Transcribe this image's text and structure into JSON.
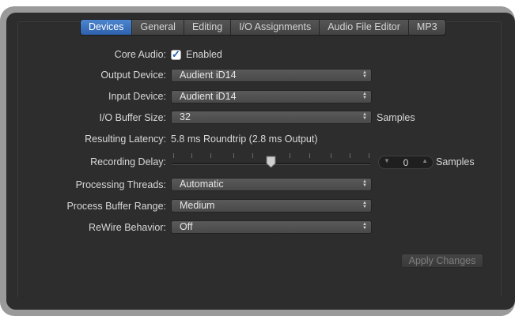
{
  "tabs": [
    "Devices",
    "General",
    "Editing",
    "I/O Assignments",
    "Audio File Editor",
    "MP3"
  ],
  "core_audio": {
    "label": "Core Audio:",
    "checkbox_label": "Enabled",
    "checked": true
  },
  "output_device": {
    "label": "Output Device:",
    "value": "Audient iD14"
  },
  "input_device": {
    "label": "Input Device:",
    "value": "Audient iD14"
  },
  "io_buffer": {
    "label": "I/O Buffer Size:",
    "value": "32",
    "unit": "Samples"
  },
  "latency": {
    "label": "Resulting Latency:",
    "value": "5.8 ms Roundtrip (2.8 ms Output)"
  },
  "recording_delay": {
    "label": "Recording Delay:",
    "value": "0",
    "unit": "Samples"
  },
  "processing_threads": {
    "label": "Processing Threads:",
    "value": "Automatic"
  },
  "process_buffer": {
    "label": "Process Buffer Range:",
    "value": "Medium"
  },
  "rewire": {
    "label": "ReWire Behavior:",
    "value": "Off"
  },
  "apply_button": "Apply Changes"
}
